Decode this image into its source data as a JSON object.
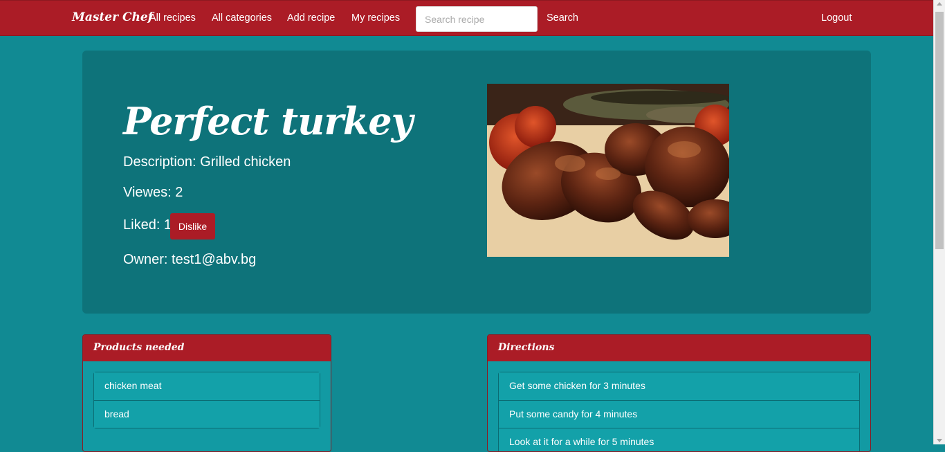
{
  "navbar": {
    "brand": "Master Chef",
    "links": [
      "All recipes",
      "All categories",
      "Add recipe",
      "My recipes"
    ],
    "search_placeholder": "Search recipe",
    "search_label": "Search",
    "logout_label": "Logout"
  },
  "recipe": {
    "title": "Perfect turkey",
    "description": "Description: Grilled chicken",
    "views": "Viewes: 2",
    "liked": "Liked: 1",
    "dislike_label": "Dislike",
    "owner": "Owner: test1@abv.bg"
  },
  "products": {
    "heading": "Products needed",
    "items": [
      "chicken meat",
      "bread"
    ]
  },
  "directions": {
    "heading": "Directions",
    "items": [
      "Get some chicken for 3 minutes",
      "Put some candy for 4 minutes",
      "Look at it for a while for 5 minutes"
    ]
  },
  "colors": {
    "brand_red": "#ab1c26",
    "background_teal": "#118a93",
    "hero_teal": "#0e737a"
  }
}
